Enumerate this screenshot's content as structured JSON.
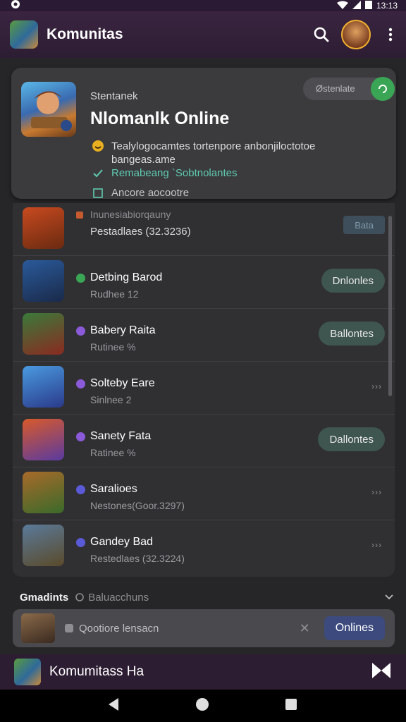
{
  "status": {
    "time": "13:13"
  },
  "appbar": {
    "title": "Komunitas"
  },
  "featured": {
    "eyebrow": "Stentanek",
    "title": "Nlomanlk Online",
    "pill_label": "Østenlate",
    "line1": "Tealylogocamtes tortenpore anbonjiloctotoe bangeas.ame",
    "line2": "Remabeang `Sobtnolantes",
    "line3": "Ancore aocootre"
  },
  "games": [
    {
      "name": "Inunesiabiorqauny",
      "sub": "Pestadlaes (32.3236)",
      "action": "Bata"
    },
    {
      "name": "Detbing Barod",
      "sub": "Rudhee 12",
      "action": "Dnlonles"
    },
    {
      "name": "Babery Raita",
      "sub": "Rutinee %",
      "action": "Ballontes"
    },
    {
      "name": "Solteby Eare",
      "sub": "Sinlnee 2",
      "action": "›››"
    },
    {
      "name": "Sanety Fata",
      "sub": "Ratinee %",
      "action": "Dallontes"
    },
    {
      "name": "Saralioes",
      "sub": "Nestones(Goor.3297)",
      "action": "›››"
    },
    {
      "name": "Gandey Bad",
      "sub": "Restedlaes (32.3224)",
      "action": "›››"
    }
  ],
  "section": {
    "title": "Gmadints",
    "subtitle": "Baluacchuns"
  },
  "banner": {
    "text": "Qootiore lensacn",
    "button": "Onlines"
  },
  "bottombar": {
    "title": "Komumitass Ha"
  },
  "colors": {
    "accent_green": "#3aa655",
    "teal": "#5fc9b0",
    "purple_dot": "#8a5ad8",
    "header_bg": "#2d1d33"
  }
}
